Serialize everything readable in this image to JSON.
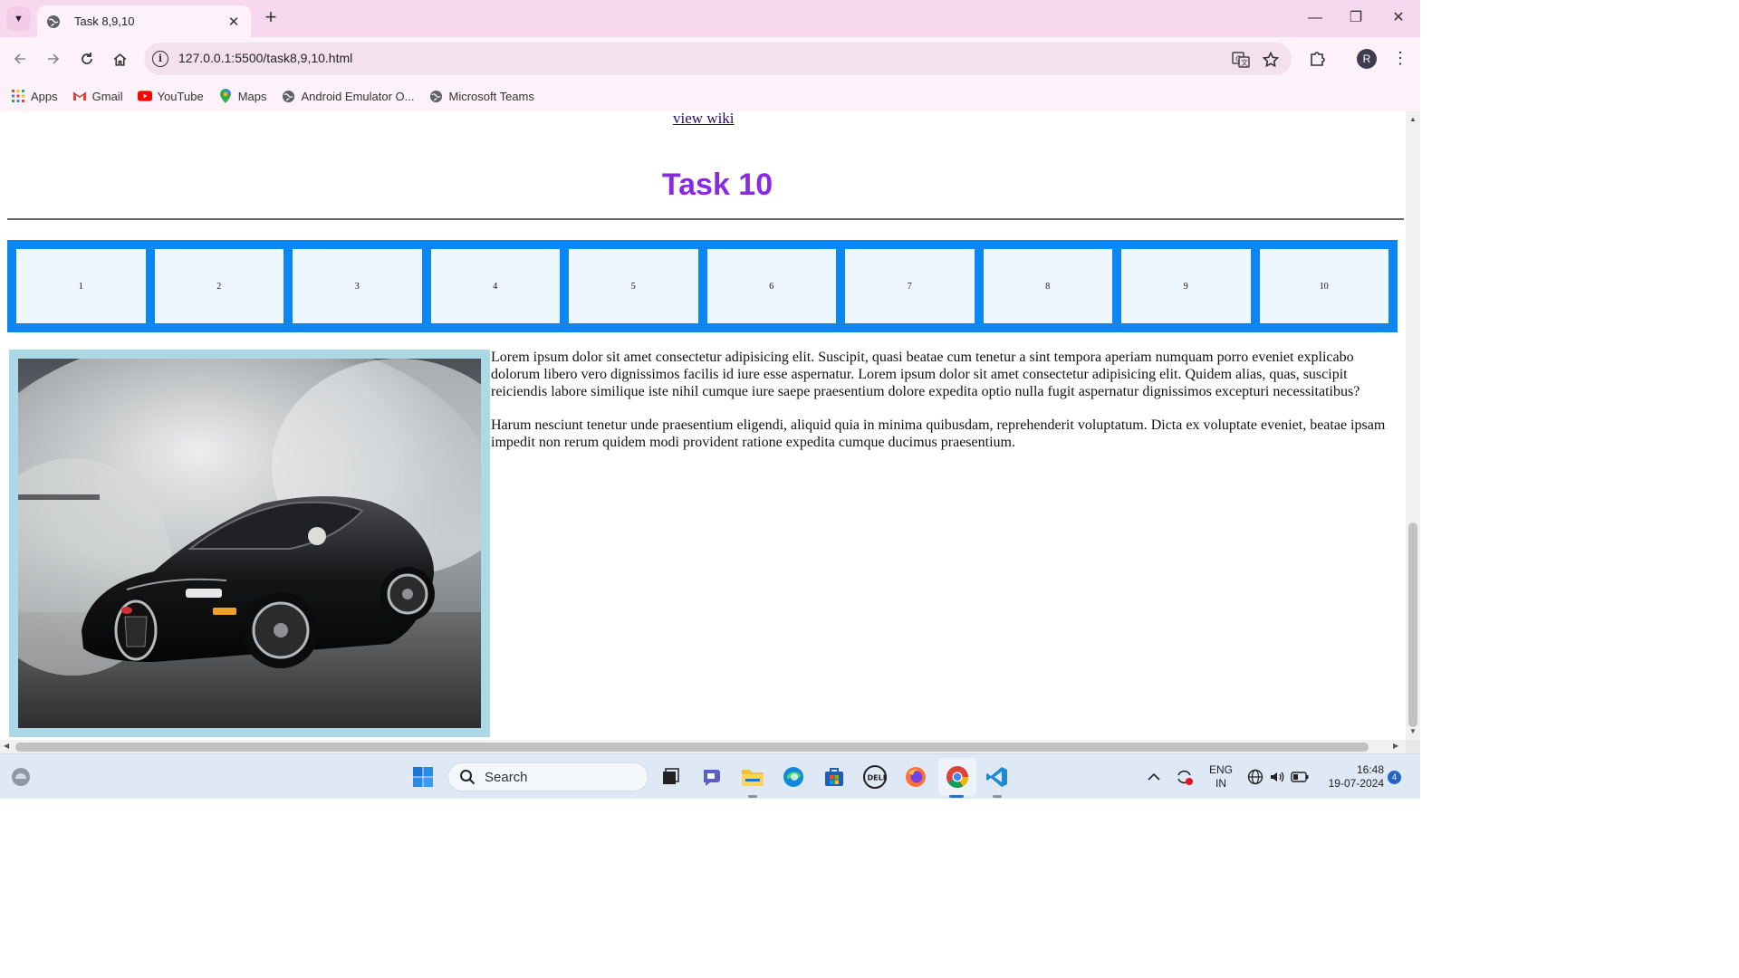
{
  "browser": {
    "tab_title": "Task 8,9,10",
    "url": "127.0.0.1:5500/task8,9,10.html",
    "profile_initial": "R",
    "bookmarks": [
      {
        "label": "Apps",
        "icon": "apps-grid-icon"
      },
      {
        "label": "Gmail",
        "icon": "gmail-icon"
      },
      {
        "label": "YouTube",
        "icon": "youtube-icon"
      },
      {
        "label": "Maps",
        "icon": "maps-pin-icon"
      },
      {
        "label": "Android Emulator O...",
        "icon": "globe-icon"
      },
      {
        "label": "Microsoft Teams",
        "icon": "globe-icon"
      }
    ]
  },
  "page": {
    "view_wiki_link": "view wiki",
    "heading": "Task 10",
    "boxes": [
      "1",
      "2",
      "3",
      "4",
      "5",
      "6",
      "7",
      "8",
      "9",
      "10"
    ],
    "image_subject": "black sports car with smoke",
    "paragraph1": "Lorem ipsum dolor sit amet consectetur adipisicing elit. Suscipit, quasi beatae cum tenetur a sint tempora aperiam numquam porro eveniet explicabo dolorum libero vero dignissimos facilis id iure esse aspernatur. Lorem ipsum dolor sit amet consectetur adipisicing elit. Quidem alias, quas, suscipit reiciendis labore similique iste nihil cumque iure saepe praesentium dolore expedita optio nulla fugit aspernatur dignissimos excepturi necessitatibus?",
    "paragraph2": "Harum nesciunt tenetur unde praesentium eligendi, aliquid quia in minima quibusdam, reprehenderit voluptatum. Dicta ex voluptate eveniet, beatae ipsam impedit non rerum quidem modi provident ratione expedita cumque ducimus praesentium."
  },
  "colors": {
    "heading": "#8a2be2",
    "box_container": "#0c86f2",
    "box_fill": "#eef6ff",
    "image_frame": "#add8e6",
    "chrome_bg": "#fdf2f9"
  },
  "taskbar": {
    "search_placeholder": "Search",
    "language_line1": "ENG",
    "language_line2": "IN",
    "time": "16:48",
    "date": "19-07-2024",
    "notification_count": "4"
  }
}
